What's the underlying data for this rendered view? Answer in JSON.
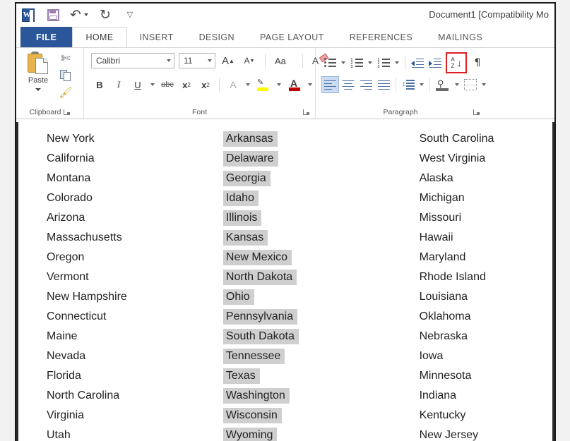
{
  "window": {
    "title": "Document1 [Compatibility Mo"
  },
  "quick_access": {
    "items": [
      {
        "name": "word-app-icon",
        "label": "W"
      },
      {
        "name": "save-icon",
        "label": "Save"
      },
      {
        "name": "undo-icon",
        "label": "↶"
      },
      {
        "name": "redo-icon",
        "label": "↺"
      },
      {
        "name": "customize-qat-icon",
        "label": "▾"
      }
    ]
  },
  "ribbon": {
    "tabs": [
      {
        "label": "FILE",
        "state": "file"
      },
      {
        "label": "HOME",
        "state": "active"
      },
      {
        "label": "INSERT",
        "state": "normal"
      },
      {
        "label": "DESIGN",
        "state": "normal"
      },
      {
        "label": "PAGE LAYOUT",
        "state": "normal"
      },
      {
        "label": "REFERENCES",
        "state": "normal"
      },
      {
        "label": "MAILINGS",
        "state": "normal"
      }
    ],
    "groups": {
      "clipboard": {
        "label": "Clipboard",
        "paste_label": "Paste",
        "cut_label": "Cut",
        "copy_label": "Copy",
        "format_painter_label": "Format Painter"
      },
      "font": {
        "label": "Font",
        "font_name": "Calibri",
        "font_size": "11",
        "grow_label": "A",
        "shrink_label": "A",
        "change_case_label": "Aa",
        "clear_formatting_label": "Clear All Formatting",
        "bold_label": "B",
        "italic_label": "I",
        "underline_label": "U",
        "strikethrough_label": "abc",
        "subscript_label": "x",
        "superscript_label": "x",
        "text_effects_label": "A",
        "highlight_label": "Text Highlight Color",
        "font_color_label": "A"
      },
      "paragraph": {
        "label": "Paragraph",
        "bullets_label": "Bullets",
        "numbering_label": "Numbering",
        "multilevel_label": "Multilevel List",
        "decrease_indent_label": "Decrease Indent",
        "increase_indent_label": "Increase Indent",
        "sort_label": "Sort",
        "show_marks_label": "¶",
        "align_left_label": "Align Left",
        "align_center_label": "Center",
        "align_right_label": "Align Right",
        "justify_label": "Justify",
        "line_spacing_label": "Line and Paragraph Spacing",
        "shading_label": "Shading",
        "borders_label": "Borders",
        "highlighted_button": "sort",
        "highlight_color": "#e02020",
        "selected_button": "align-left",
        "selection_color": "#cddcf0"
      }
    }
  },
  "document": {
    "selection_color": "#cfcfcf",
    "columns": [
      {
        "name": "column-one",
        "selected": false,
        "items": [
          "New York",
          "California",
          "Montana",
          "Colorado",
          "Arizona",
          "Massachusetts",
          "Oregon",
          "Vermont",
          "New Hampshire",
          "Connecticut",
          "Maine",
          "Nevada",
          "Florida",
          "North Carolina",
          "Virginia",
          "Utah"
        ]
      },
      {
        "name": "column-two",
        "selected": true,
        "items": [
          "Arkansas",
          "Delaware",
          "Georgia",
          "Idaho",
          "Illinois",
          "Kansas",
          "New Mexico",
          "North Dakota",
          "Ohio",
          "Pennsylvania",
          "South Dakota",
          "Tennessee",
          "Texas",
          "Washington",
          "Wisconsin",
          "Wyoming"
        ]
      },
      {
        "name": "column-three",
        "selected": false,
        "items": [
          "South Carolina",
          "West Virginia",
          "Alaska",
          "Michigan",
          "Missouri",
          "Hawaii",
          "Maryland",
          "Rhode Island",
          "Louisiana",
          "Oklahoma",
          "Nebraska",
          "Iowa",
          "Minnesota",
          "Indiana",
          "Kentucky",
          "New Jersey"
        ]
      }
    ]
  }
}
